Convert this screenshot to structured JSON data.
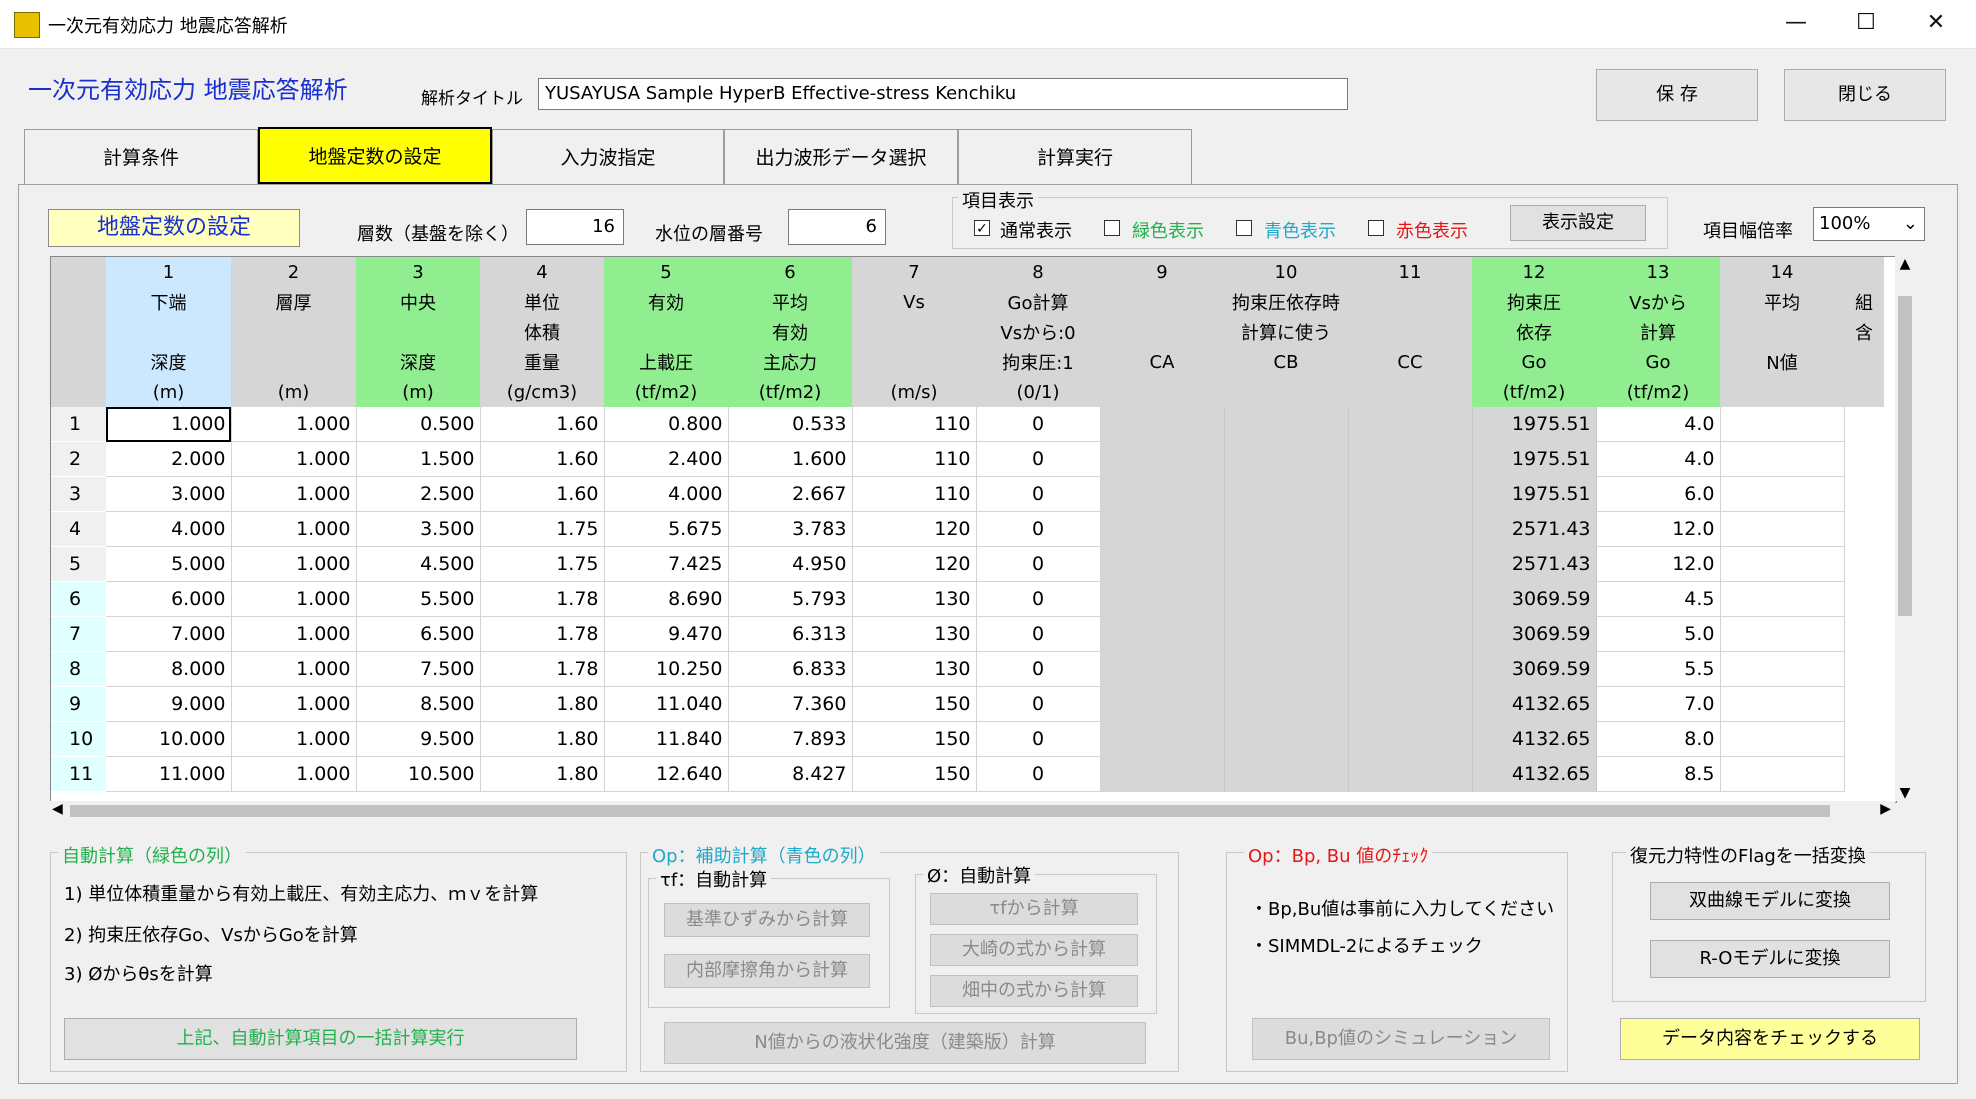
{
  "window": {
    "title": "一次元有効応力 地震応答解析",
    "min": "—",
    "max": "☐",
    "close": "✕"
  },
  "header": {
    "app_title": "一次元有効応力 地震応答解析",
    "analysis_label": "解析タイトル",
    "analysis_value": "YUSAYUSA Sample HyperB Effective-stress Kenchiku",
    "save": "保 存",
    "close": "閉じる"
  },
  "tabs": [
    "計算条件",
    "地盤定数の設定",
    "入力波指定",
    "出力波形データ選択",
    "計算実行"
  ],
  "section": {
    "title": "地盤定数の設定",
    "layers_label": "層数（基盤を除く）",
    "layers_value": "16",
    "water_label": "水位の層番号",
    "water_value": "6"
  },
  "display": {
    "group": "項目表示",
    "normal": "通常表示",
    "green": "緑色表示",
    "blue": "青色表示",
    "red": "赤色表示",
    "normal_checked": "✓",
    "settings": "表示設定",
    "zoom_label": "項目幅倍率",
    "zoom_value": "100%"
  },
  "colors": {
    "green_header": "#90ee90",
    "blue_header": "#cce8ff",
    "gray_header": "#d6d6d6",
    "active_tab": "#ffff00",
    "note_button": "#ffff99"
  },
  "grid": {
    "col_numbers": [
      "1",
      "2",
      "3",
      "4",
      "5",
      "6",
      "7",
      "8",
      "9",
      "10",
      "11",
      "12",
      "13",
      "14"
    ],
    "header_rows": [
      [
        "下端",
        "層厚",
        "中央",
        "単位",
        "有効",
        "平均",
        "Vs",
        "Go計算",
        "拘束圧依存時",
        "拘束圧",
        "Vsから",
        "平均",
        "組"
      ],
      [
        "",
        "",
        "",
        "体積",
        "",
        "有効",
        "",
        "Vsから:0",
        "計算に使う",
        "依存",
        "計算",
        "",
        "含"
      ],
      [
        "深度",
        "",
        "深度",
        "重量",
        "上載圧",
        "主応力",
        "",
        "拘束圧:1",
        "CA",
        "CB",
        "CC",
        "Go",
        "Go",
        "N値"
      ],
      [
        "(m)",
        "(m)",
        "(m)",
        "(g/cm3)",
        "(tf/m2)",
        "(tf/m2)",
        "(m/s)",
        "(0/1)",
        "",
        "",
        "",
        "(tf/m2)",
        "(tf/m2)",
        ""
      ]
    ],
    "rows": [
      [
        "1",
        "1.000",
        "1.000",
        "0.500",
        "1.60",
        "0.800",
        "0.533",
        "110",
        "0",
        "",
        "",
        "",
        "1975.51",
        "4.0"
      ],
      [
        "2",
        "2.000",
        "1.000",
        "1.500",
        "1.60",
        "2.400",
        "1.600",
        "110",
        "0",
        "",
        "",
        "",
        "1975.51",
        "4.0"
      ],
      [
        "3",
        "3.000",
        "1.000",
        "2.500",
        "1.60",
        "4.000",
        "2.667",
        "110",
        "0",
        "",
        "",
        "",
        "1975.51",
        "6.0"
      ],
      [
        "4",
        "4.000",
        "1.000",
        "3.500",
        "1.75",
        "5.675",
        "3.783",
        "120",
        "0",
        "",
        "",
        "",
        "2571.43",
        "12.0"
      ],
      [
        "5",
        "5.000",
        "1.000",
        "4.500",
        "1.75",
        "7.425",
        "4.950",
        "120",
        "0",
        "",
        "",
        "",
        "2571.43",
        "12.0"
      ],
      [
        "6",
        "6.000",
        "1.000",
        "5.500",
        "1.78",
        "8.690",
        "5.793",
        "130",
        "0",
        "",
        "",
        "",
        "3069.59",
        "4.5"
      ],
      [
        "7",
        "7.000",
        "1.000",
        "6.500",
        "1.78",
        "9.470",
        "6.313",
        "130",
        "0",
        "",
        "",
        "",
        "3069.59",
        "5.0"
      ],
      [
        "8",
        "8.000",
        "1.000",
        "7.500",
        "1.78",
        "10.250",
        "6.833",
        "130",
        "0",
        "",
        "",
        "",
        "3069.59",
        "5.5"
      ],
      [
        "9",
        "9.000",
        "1.000",
        "8.500",
        "1.80",
        "11.040",
        "7.360",
        "150",
        "0",
        "",
        "",
        "",
        "4132.65",
        "7.0"
      ],
      [
        "10",
        "10.000",
        "1.000",
        "9.500",
        "1.80",
        "11.840",
        "7.893",
        "150",
        "0",
        "",
        "",
        "",
        "4132.65",
        "8.0"
      ],
      [
        "11",
        "11.000",
        "1.000",
        "10.500",
        "1.80",
        "12.640",
        "8.427",
        "150",
        "0",
        "",
        "",
        "",
        "4132.65",
        "8.5"
      ]
    ]
  },
  "auto": {
    "title": "自動計算（緑色の列）",
    "line1": "1) 単位体積重量から有効上載圧、有効主応力、ｍｖを計算",
    "line2": "2) 拘束圧依存Go、VsからGoを計算",
    "line3": "3) Øからθsを計算",
    "run": "上記、自動計算項目の一括計算実行"
  },
  "aux": {
    "title": "Op：補助計算（青色の列）",
    "tf_title": "τf：自動計算",
    "btn1": "基準ひずみから計算",
    "btn2": "内部摩擦角から計算",
    "phi_title": "Ø：自動計算",
    "btn3": "τfから計算",
    "btn4": "大崎の式から計算",
    "btn5": "畑中の式から計算",
    "liq": "N値からの液状化強度（建築版）計算"
  },
  "bp": {
    "title": "Op：Bp, Bu 値のﾁｪｯｸ",
    "line1": "・Bp,Bu値は事前に入力してください",
    "line2": "・SIMMDL-2によるチェック",
    "sim": "Bu,Bp値のシミュレーション"
  },
  "flag": {
    "title": "復元力特性のFlagを一括変換",
    "btn1": "双曲線モデルに変換",
    "btn2": "R-Oモデルに変換",
    "check": "データ内容をチェックする"
  }
}
